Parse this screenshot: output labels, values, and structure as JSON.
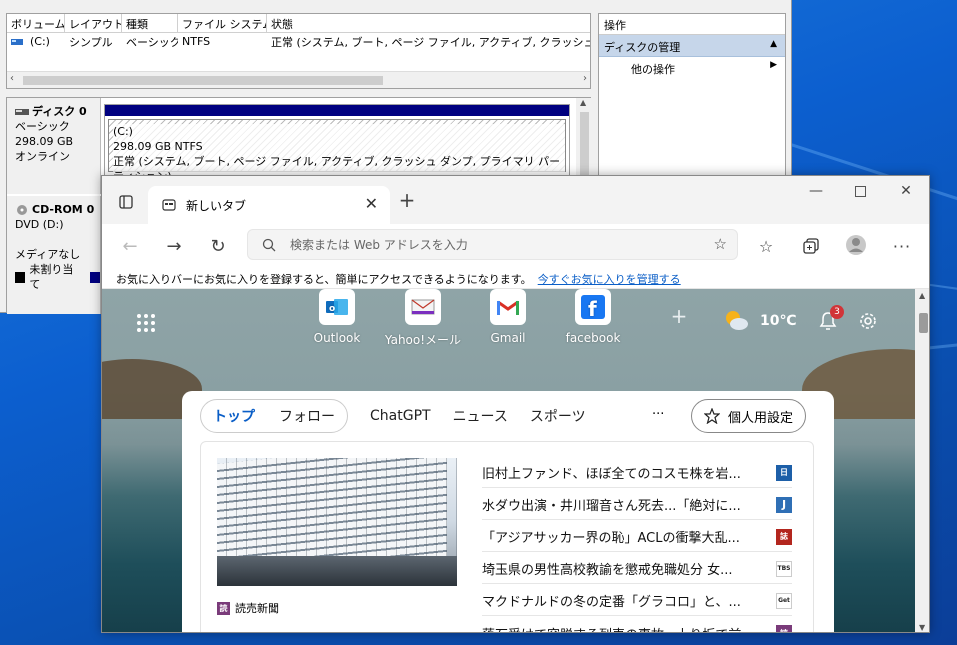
{
  "disk_mgmt": {
    "columns": [
      "ボリューム",
      "レイアウト",
      "種類",
      "ファイル システム",
      "状態"
    ],
    "volume_row": [
      "(C:)",
      "シンプル",
      "ベーシック",
      "NTFS",
      "正常 (システム, ブート, ページ ファイル, アクティブ, クラッシュ ダンプ, プライ"
    ],
    "actions_title": "操作",
    "actions_section": "ディスクの管理",
    "actions_other": "他の操作",
    "disk0": {
      "name": "ディスク 0",
      "type": "ベーシック",
      "size": "298.09 GB",
      "status": "オンライン"
    },
    "partition": {
      "name": "(C:)",
      "size": "298.09 GB NTFS",
      "status": "正常 (システム, ブート, ページ ファイル, アクティブ, クラッシュ ダンプ, プライマリ パーティション)"
    },
    "cdrom": {
      "name": "CD-ROM 0",
      "drive": "DVD (D:)",
      "media": "メディアなし"
    },
    "legend_unallocated": "未割り当て"
  },
  "browser": {
    "tab_title": "新しいタブ",
    "address_placeholder": "検索または Web アドレスを入力",
    "favorites_hint": "お気に入りバーにお気に入りを登録すると、簡単にアクセスできるようになります。",
    "favorites_link": "今すぐお気に入りを管理する",
    "quick_links": [
      {
        "label": "Outlook",
        "icon": "outlook-icon",
        "color": "#0f6cbd"
      },
      {
        "label": "Yahoo!メール",
        "icon": "yahoo-mail-icon",
        "color": "#7b2fbf"
      },
      {
        "label": "Gmail",
        "icon": "gmail-icon",
        "color": "#d93025"
      },
      {
        "label": "facebook",
        "icon": "facebook-icon",
        "color": "#1877f2"
      }
    ],
    "weather_temp": "10℃",
    "notification_count": "3",
    "feed_tabs": [
      "トップ",
      "フォロー",
      "ChatGPT",
      "ニュース",
      "スポーツ"
    ],
    "more_label": "···",
    "personalize_label": "個人用設定",
    "featured_source": "読売新聞",
    "headlines": [
      {
        "title": "旧村上ファンド、ほぼ全てのコスモ株を岩...",
        "source_icon": "nikkei-icon",
        "color": "#1d5fa8",
        "mark": "日"
      },
      {
        "title": "水ダウ出演・井川瑠音さん死去...「絶対に...",
        "source_icon": "j-icon",
        "color": "#2f6fb5",
        "mark": "J"
      },
      {
        "title": "「アジアサッカー界の恥」ACLの衝撃大乱...",
        "source_icon": "magazine-icon",
        "color": "#b3261e",
        "mark": "誌"
      },
      {
        "title": "埼玉県の男性高校教諭を懲戒免職処分 女...",
        "source_icon": "tbs-icon",
        "color": "#ffffff",
        "mark": "TBS"
      },
      {
        "title": "マクドナルドの冬の定番「グラコロ」と、...",
        "source_icon": "getnavi-icon",
        "color": "#ffffff",
        "mark": "Get"
      },
      {
        "title": "落石受けて突脱する列車の事故...上り坂で前...",
        "source_icon": "yomiuri-icon",
        "color": "#7a3b7a",
        "mark": "読"
      }
    ]
  }
}
